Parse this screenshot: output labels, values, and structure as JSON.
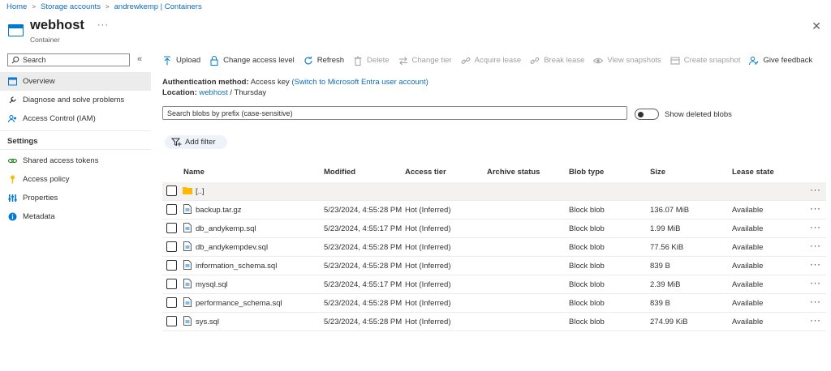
{
  "breadcrumb": {
    "home": "Home",
    "storage_accounts": "Storage accounts",
    "container_path": "andrewkemp | Containers"
  },
  "header": {
    "title": "webhost",
    "subtitle": "Container",
    "more": "···",
    "close": "✕",
    "icon": "container-icon"
  },
  "sidebar": {
    "search_placeholder": "Search",
    "collapse": "«",
    "items": [
      {
        "label": "Overview",
        "icon": "overview-icon"
      },
      {
        "label": "Diagnose and solve problems",
        "icon": "wrench-icon"
      },
      {
        "label": "Access Control (IAM)",
        "icon": "iam-icon"
      }
    ],
    "settings_heading": "Settings",
    "settings_items": [
      {
        "label": "Shared access tokens",
        "icon": "link-icon"
      },
      {
        "label": "Access policy",
        "icon": "key-icon"
      },
      {
        "label": "Properties",
        "icon": "properties-icon"
      },
      {
        "label": "Metadata",
        "icon": "info-icon"
      }
    ]
  },
  "toolbar": {
    "upload": "Upload",
    "change_access_level": "Change access level",
    "refresh": "Refresh",
    "delete": "Delete",
    "change_tier": "Change tier",
    "acquire_lease": "Acquire lease",
    "break_lease": "Break lease",
    "view_snapshots": "View snapshots",
    "create_snapshot": "Create snapshot",
    "give_feedback": "Give feedback"
  },
  "info": {
    "auth_label": "Authentication method:",
    "auth_value": "Access key",
    "auth_switch": "(Switch to Microsoft Entra user account)",
    "location_label": "Location:",
    "location_link": "webhost",
    "location_sep": "/",
    "location_folder": "Thursday"
  },
  "search_blobs": {
    "placeholder": "Search blobs by prefix (case-sensitive)"
  },
  "show_deleted": {
    "label": "Show deleted blobs",
    "enabled": false
  },
  "add_filter": "Add filter",
  "table": {
    "columns": [
      "Name",
      "Modified",
      "Access tier",
      "Archive status",
      "Blob type",
      "Size",
      "Lease state"
    ],
    "parent_row": "[..]",
    "rows": [
      {
        "name": "backup.tar.gz",
        "modified": "5/23/2024, 4:55:28 PM",
        "tier": "Hot (Inferred)",
        "archive": "",
        "type": "Block blob",
        "size": "136.07 MiB",
        "lease": "Available"
      },
      {
        "name": "db_andykemp.sql",
        "modified": "5/23/2024, 4:55:17 PM",
        "tier": "Hot (Inferred)",
        "archive": "",
        "type": "Block blob",
        "size": "1.99 MiB",
        "lease": "Available"
      },
      {
        "name": "db_andykempdev.sql",
        "modified": "5/23/2024, 4:55:28 PM",
        "tier": "Hot (Inferred)",
        "archive": "",
        "type": "Block blob",
        "size": "77.56 KiB",
        "lease": "Available"
      },
      {
        "name": "information_schema.sql",
        "modified": "5/23/2024, 4:55:28 PM",
        "tier": "Hot (Inferred)",
        "archive": "",
        "type": "Block blob",
        "size": "839 B",
        "lease": "Available"
      },
      {
        "name": "mysql.sql",
        "modified": "5/23/2024, 4:55:17 PM",
        "tier": "Hot (Inferred)",
        "archive": "",
        "type": "Block blob",
        "size": "2.39 MiB",
        "lease": "Available"
      },
      {
        "name": "performance_schema.sql",
        "modified": "5/23/2024, 4:55:28 PM",
        "tier": "Hot (Inferred)",
        "archive": "",
        "type": "Block blob",
        "size": "839 B",
        "lease": "Available"
      },
      {
        "name": "sys.sql",
        "modified": "5/23/2024, 4:55:28 PM",
        "tier": "Hot (Inferred)",
        "archive": "",
        "type": "Block blob",
        "size": "274.99 KiB",
        "lease": "Available"
      }
    ],
    "row_more": "···"
  },
  "colors": {
    "link": "#0f6cbd",
    "accent": "#0078d4",
    "disabled": "#a19f9d",
    "folder": "#ffb900"
  }
}
